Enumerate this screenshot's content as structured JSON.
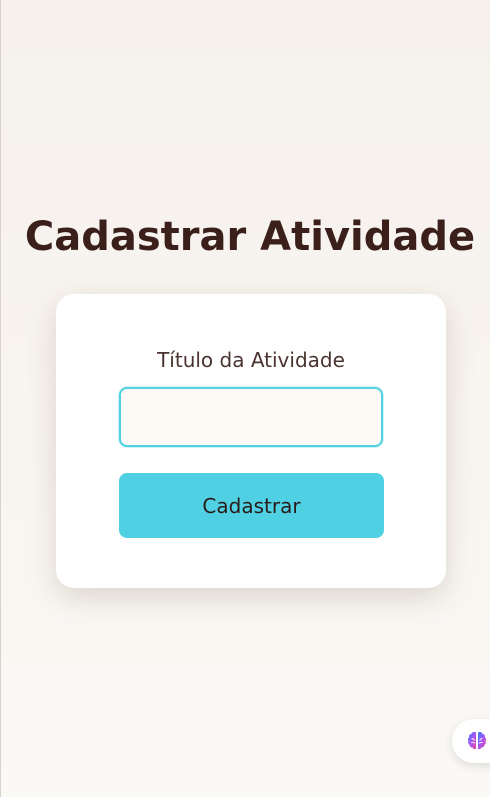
{
  "page": {
    "title": "Cadastrar Atividade"
  },
  "form": {
    "field_label": "Título da Atividade",
    "input_value": "",
    "input_placeholder": "",
    "submit_label": "Cadastrar"
  },
  "assistant": {
    "icon": "brain-icon"
  },
  "colors": {
    "accent": "#4fd0e3",
    "title_text": "#3a1f1a",
    "input_background": "#fdfaf5"
  }
}
